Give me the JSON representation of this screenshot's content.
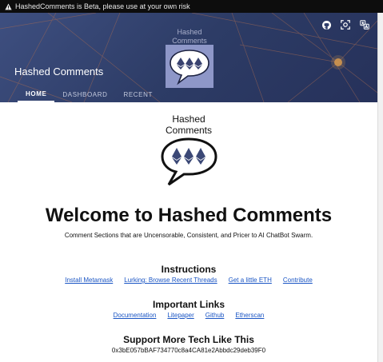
{
  "beta_banner": {
    "text": "HashedComments is Beta, please use at your own risk"
  },
  "header": {
    "title": "Hashed Comments",
    "logo_text_line1": "Hashed",
    "logo_text_line2": "Comments",
    "icons": [
      "github-icon",
      "camera-scan-icon",
      "translate-icon"
    ],
    "tabs": [
      {
        "label": "HOME",
        "active": true
      },
      {
        "label": "DASHBOARD",
        "active": false
      },
      {
        "label": "RECENT",
        "active": false
      }
    ]
  },
  "main": {
    "logo_text_line1": "Hashed",
    "logo_text_line2": "Comments",
    "welcome": "Welcome to Hashed Comments",
    "tagline": "Comment Sections that are Uncensorable, Consistent, and Pricer to AI ChatBot Swarm.",
    "instructions": {
      "heading": "Instructions",
      "links": [
        "Install Metamask",
        "Lurking: Browse Recent Threads",
        "Get a little ETH",
        "Contribute"
      ]
    },
    "important_links": {
      "heading": "Important Links",
      "links": [
        "Documentation",
        "Litepaper",
        "Github",
        "Etherscan"
      ]
    },
    "support": {
      "heading": "Support More Tech Like This",
      "address": "0x3bE057bBAF734770c8a4CA81e2Abbdc29deb39F0"
    }
  },
  "colors": {
    "hero": "#34436f",
    "link": "#1a55c4",
    "tab_indicator": "#ffffff",
    "logo_bg": "#8e97c8"
  }
}
